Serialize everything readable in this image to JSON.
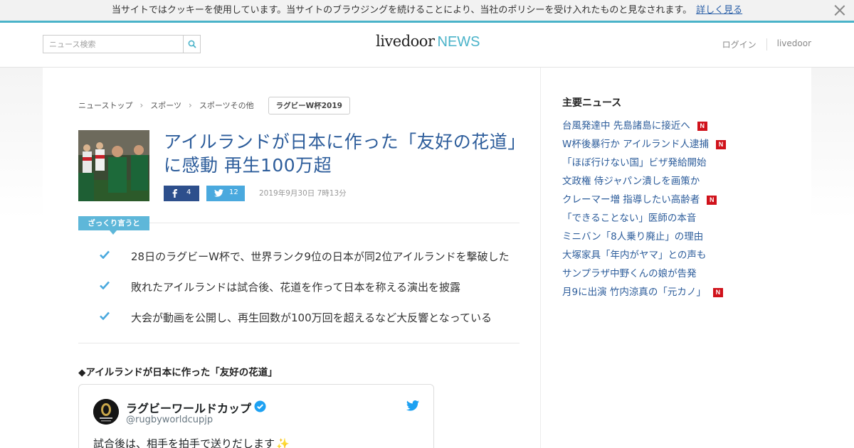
{
  "cookie_bar": {
    "message": "当サイトではクッキーを使用しています。当サイトのブラウジングを続けることにより、当社のポリシーを受け入れたものと見なされます。",
    "link_label": "詳しく見る"
  },
  "header": {
    "search_placeholder": "ニュース検索",
    "logo_main": "livedoor",
    "logo_news": "NEWS",
    "login_label": "ログイン",
    "livedoor_label": "livedoor"
  },
  "breadcrumb": {
    "items": [
      "ニューストップ",
      "スポーツ",
      "スポーツその他"
    ],
    "tag": "ラグビーW杯2019"
  },
  "article": {
    "title": "アイルランドが日本に作った「友好の花道」に感動 再生100万超",
    "facebook_count": "4",
    "twitter_count": "12",
    "date": "2019年9月30日 7時13分",
    "summary_label": "ざっくり言うと",
    "summary": [
      "28日のラグビーW杯で、世界ランク9位の日本が同2位アイルランドを撃破した",
      "敗れたアイルランドは試合後、花道を作って日本を称える演出を披露",
      "大会が動画を公開し、再生回数が100万回を超えるなど大反響となっている"
    ],
    "subheading": "◆アイルランドが日本に作った「友好の花道」"
  },
  "tweet": {
    "name": "ラグビーワールドカップ",
    "handle": "@rugbyworldcupjp",
    "text": "試合後は、相手を拍手で送りだします"
  },
  "sidebar": {
    "title": "主要ニュース",
    "items": [
      {
        "label": "台風発達中 先島諸島に接近へ",
        "new": true
      },
      {
        "label": "W杯後暴行か アイルランド人逮捕",
        "new": true
      },
      {
        "label": "「ほぼ行けない国」ビザ発給開始",
        "new": false
      },
      {
        "label": "文政権 侍ジャパン潰しを画策か",
        "new": false
      },
      {
        "label": "クレーマー増 指導したい高齢者",
        "new": true
      },
      {
        "label": "「できることない」医師の本音",
        "new": false
      },
      {
        "label": "ミニバン「8人乗り廃止」の理由",
        "new": false
      },
      {
        "label": "大塚家具「年内がヤマ」との声も",
        "new": false
      },
      {
        "label": "サンプラザ中野くんの娘が告発",
        "new": false
      },
      {
        "label": "月9に出演 竹内涼真の「元カノ」",
        "new": true
      }
    ],
    "new_badge": "N"
  },
  "colors": {
    "accent": "#4ab3c9",
    "title_blue": "#2d5d9b",
    "facebook": "#2d4f8c",
    "twitter": "#4aa9de",
    "badge_red": "#d0121b"
  }
}
